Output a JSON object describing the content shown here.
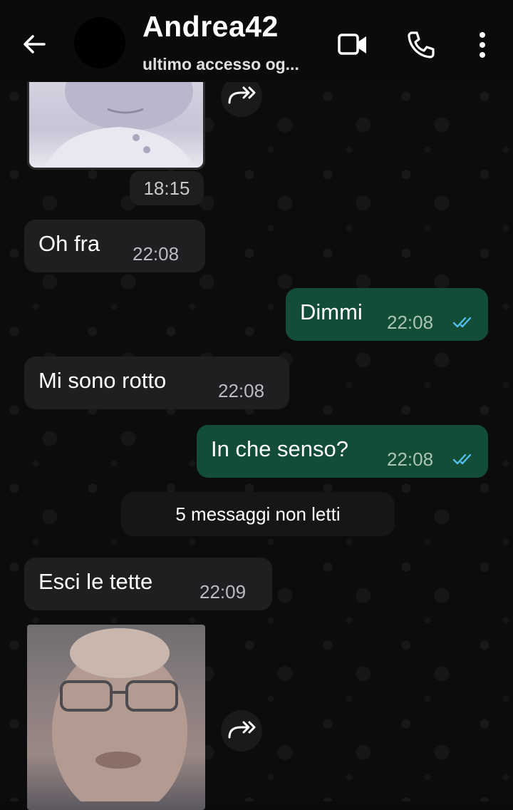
{
  "header": {
    "contact_name": "Andrea42",
    "status": "ultimo accesso og..."
  },
  "messages": [
    {
      "type": "image",
      "direction": "incoming",
      "time": "18:15"
    },
    {
      "type": "text",
      "direction": "incoming",
      "text": "Oh fra",
      "time": "22:08"
    },
    {
      "type": "text",
      "direction": "outgoing",
      "text": "Dimmi",
      "time": "22:08",
      "status": "read"
    },
    {
      "type": "text",
      "direction": "incoming",
      "text": "Mi sono rotto",
      "time": "22:08"
    },
    {
      "type": "text",
      "direction": "outgoing",
      "text": "In che senso?",
      "time": "22:08",
      "status": "read"
    },
    {
      "type": "text",
      "direction": "incoming",
      "text": "Esci le tette",
      "time": "22:09"
    },
    {
      "type": "image",
      "direction": "incoming"
    }
  ],
  "unread_banner": "5 messaggi non letti",
  "icons": {
    "back": "arrow-left-icon",
    "video": "video-camera-icon",
    "call": "phone-icon",
    "more": "more-vertical-icon",
    "forward": "forward-icon",
    "read": "double-check-icon"
  },
  "colors": {
    "incoming_bubble": "#1f1f21",
    "outgoing_bubble": "#134d37",
    "read_tick": "#53bdeb"
  }
}
